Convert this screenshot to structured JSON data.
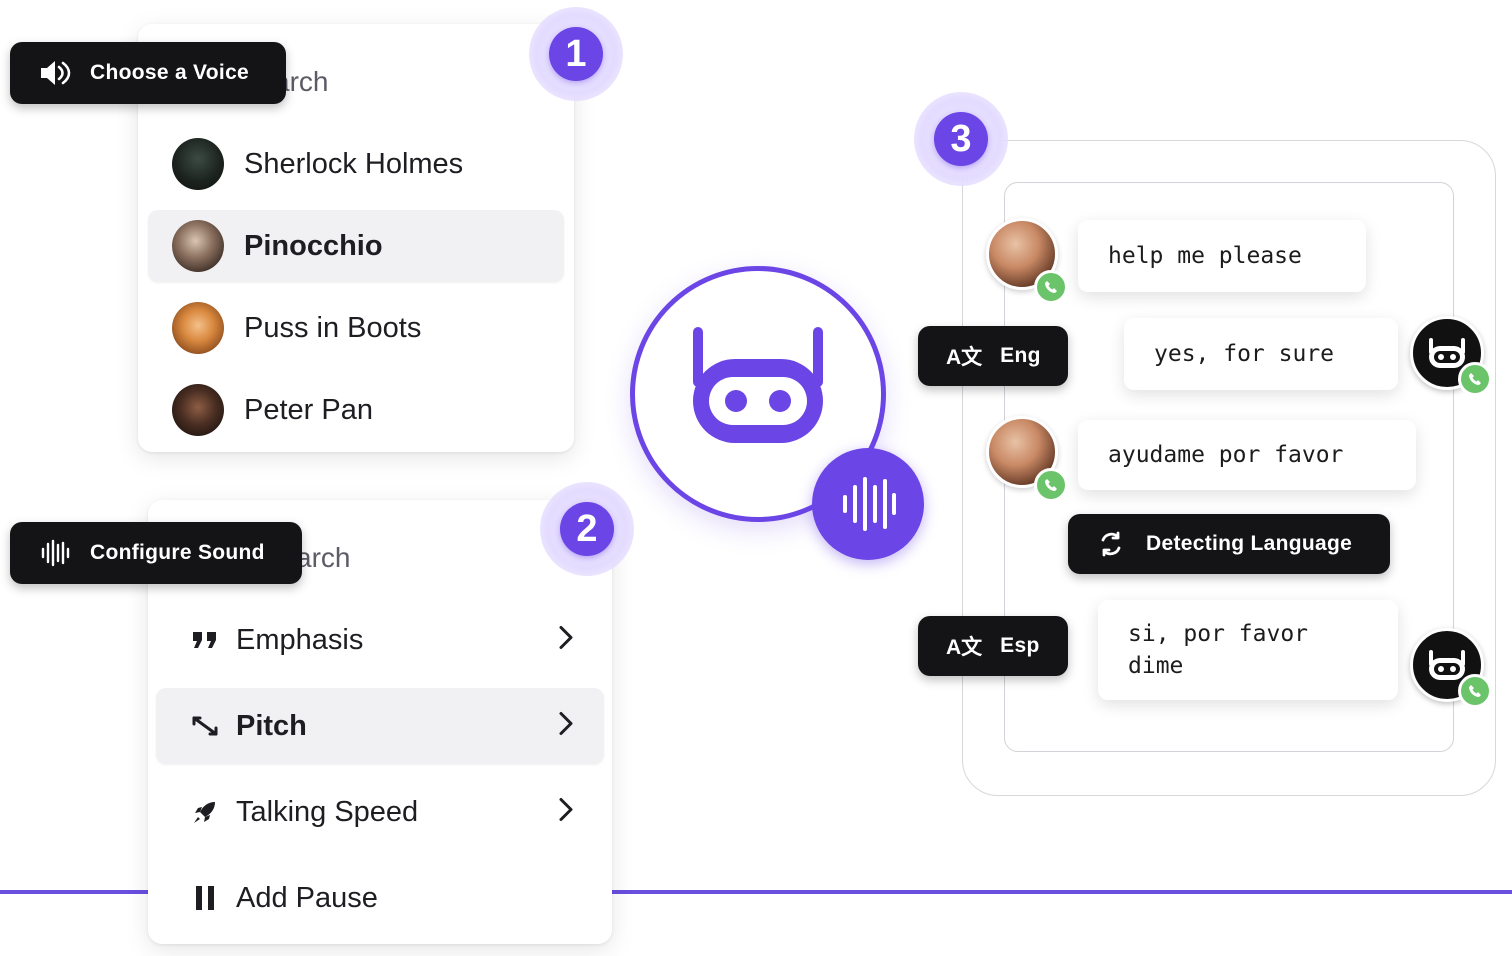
{
  "badges": {
    "step1": "1",
    "step2": "2",
    "step3": "3"
  },
  "voice_panel": {
    "pill_label": "Choose a Voice",
    "pill_icon": "speaker-icon",
    "search_partial": "arch",
    "voices": [
      {
        "name": "Sherlock Holmes",
        "selected": false
      },
      {
        "name": "Pinocchio",
        "selected": true
      },
      {
        "name": "Puss in Boots",
        "selected": false
      },
      {
        "name": "Peter Pan",
        "selected": false
      }
    ]
  },
  "sound_panel": {
    "pill_label": "Configure Sound",
    "pill_icon": "waveform-icon",
    "search_partial": "arch",
    "options": [
      {
        "label": "Emphasis",
        "icon": "quote-icon",
        "selected": false,
        "has_chevron": true
      },
      {
        "label": "Pitch",
        "icon": "pitch-arrows-icon",
        "selected": true,
        "has_chevron": true
      },
      {
        "label": "Talking Speed",
        "icon": "rocket-icon",
        "selected": false,
        "has_chevron": true
      },
      {
        "label": "Add Pause",
        "icon": "pause-icon",
        "selected": false,
        "has_chevron": false
      }
    ]
  },
  "chat": {
    "messages": [
      {
        "text": "help me please",
        "sender": "user"
      },
      {
        "text": "yes, for sure",
        "sender": "bot"
      },
      {
        "text": "ayudame por favor",
        "sender": "user"
      },
      {
        "text": "si, por favor\ndime",
        "sender": "bot"
      }
    ],
    "language_tags": [
      {
        "icon_text": "A文",
        "lang": "Eng"
      },
      {
        "icon_text": "A文",
        "lang": "Esp"
      }
    ],
    "detecting_label": "Detecting Language"
  },
  "colors": {
    "accent": "#6b45e6",
    "pill_bg": "#141416",
    "call_green": "#6cc46a",
    "line": "#6a4ee0"
  }
}
